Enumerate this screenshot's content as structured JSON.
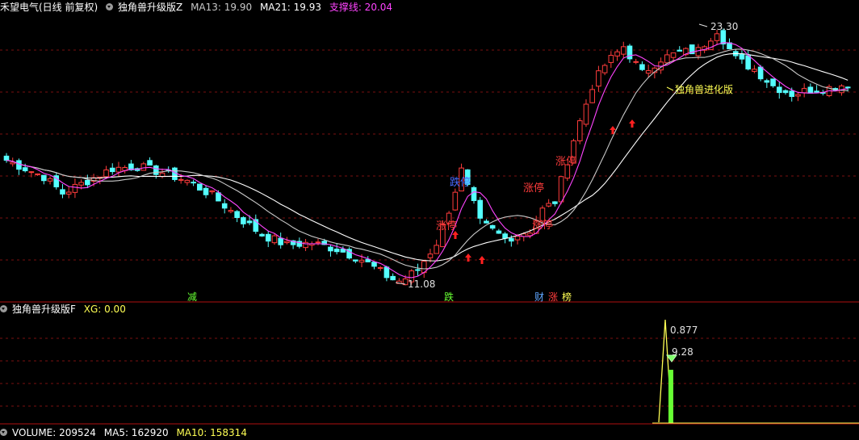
{
  "colors": {
    "up": "#ff3c3c",
    "down": "#54ffff",
    "ma1": "#ffffff",
    "ma2": "#ff44ff",
    "ma3": "#c8c8c8",
    "grid": "#7a1010",
    "sep": "#b01010",
    "label": "#c8c8c8",
    "magenta": "#ff44ff",
    "yellow": "#ffff54",
    "green": "#66ff33"
  },
  "header": {
    "stock": "禾望电气(日线 前复权)",
    "indicator": "独角兽升级版Z",
    "ma13": "MA13: 19.90",
    "ma21": "MA21: 19.93",
    "support": "支撑线: 20.04"
  },
  "main_chart": {
    "high_label": "23.30",
    "low_label": "11.08",
    "yellow_note": "独角兽进化版",
    "zt_label": "涨停",
    "dt_label": "跌停",
    "bottom_tags": [
      {
        "text": "减",
        "color": "#66ff33"
      },
      {
        "text": "跌",
        "color": "#66ff33"
      },
      {
        "text": "财",
        "color": "#5fa6ff"
      },
      {
        "text": "涨",
        "color": "#ff3c3c"
      },
      {
        "text": "榜",
        "color": "#ffff54"
      }
    ]
  },
  "sub_chart": {
    "title": "独角兽升级版F",
    "xg": "XG: 0.00",
    "v1": "0.877",
    "v2": "9.28"
  },
  "volume_bar": {
    "volume": "VOLUME: 209524",
    "ma5": "MA5: 162920",
    "ma10": "MA10: 158314"
  },
  "chart_data": {
    "type": "candlestick",
    "high": 23.3,
    "low": 11.08,
    "ma_names": [
      "MA13",
      "MA21",
      "支撑线"
    ],
    "ma_last": [
      19.9,
      19.93,
      20.04
    ]
  }
}
